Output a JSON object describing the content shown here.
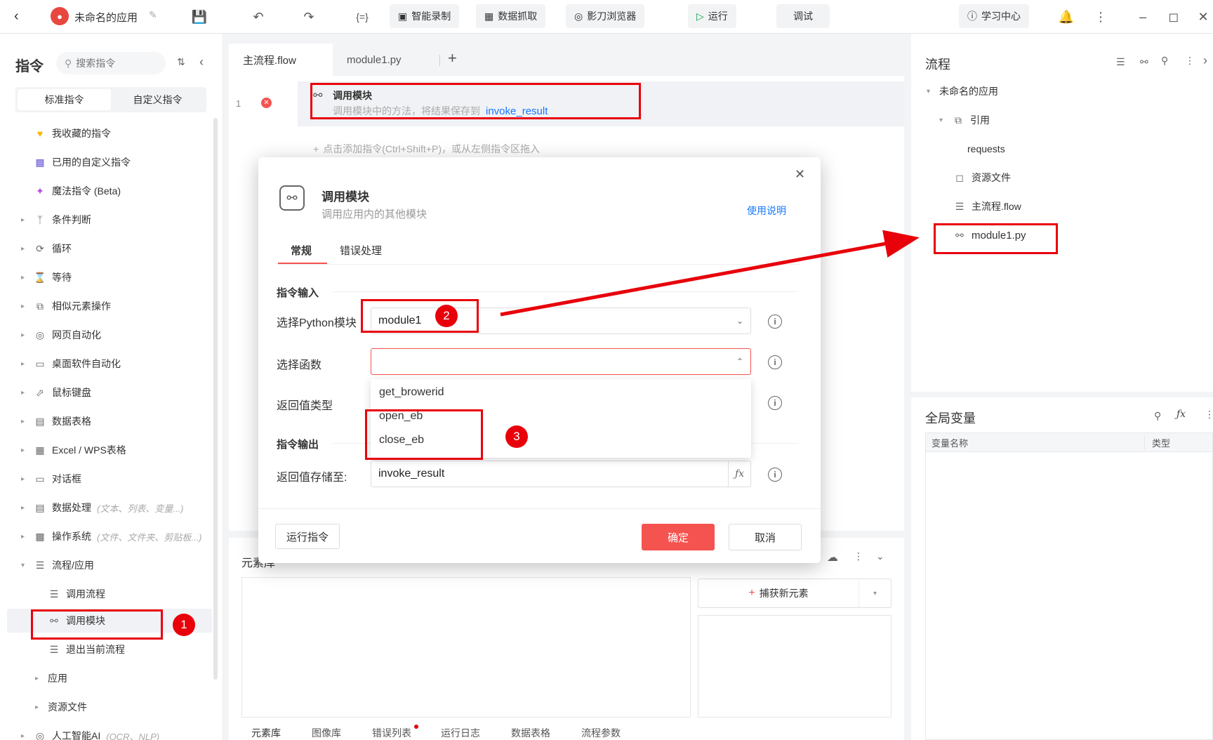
{
  "topbar": {
    "app_name": "未命名的应用",
    "buttons": {
      "smart_record": "智能录制",
      "data_capture": "数据抓取",
      "browser": "影刀浏览器",
      "run": "运行",
      "debug": "调试",
      "learning": "学习中心"
    }
  },
  "left": {
    "title": "指令",
    "search_placeholder": "搜索指令",
    "tabs": [
      "标准指令",
      "自定义指令"
    ],
    "items": {
      "fav": "我收藏的指令",
      "used_custom": "已用的自定义指令",
      "magic": "魔法指令 (Beta)",
      "cond": "条件判断",
      "loop": "循环",
      "wait": "等待",
      "similar": "相似元素操作",
      "web": "网页自动化",
      "desktop": "桌面软件自动化",
      "mouse": "鼠标键盘",
      "table": "数据表格",
      "excel": "Excel / WPS表格",
      "dialog": "对话框",
      "dataproc": "数据处理",
      "dataproc_hint": "(文本、列表、变量...)",
      "os": "操作系统",
      "os_hint": "(文件、文件夹、剪贴板...)",
      "flowapp": "流程/应用",
      "call_flow": "调用流程",
      "call_module": "调用模块",
      "exit_flow": "退出当前流程",
      "app": "应用",
      "resource": "资源文件",
      "ai": "人工智能AI",
      "ai_hint": "(OCR、NLP)"
    }
  },
  "editor": {
    "tabs": [
      "主流程.flow",
      "module1.py"
    ],
    "line_number": "1",
    "step_title": "调用模块",
    "step_desc": "调用模块中的方法，将结果保存到",
    "step_var": "invoke_result",
    "add_hint": "点击添加指令(Ctrl+Shift+P)，或从左侧指令区拖入"
  },
  "bottom": {
    "title": "元素库",
    "capture_button": "捕获新元素",
    "tabs": [
      "元素库",
      "图像库",
      "错误列表",
      "运行日志",
      "数据表格",
      "流程参数"
    ]
  },
  "right": {
    "title": "流程",
    "tree": {
      "root": "未命名的应用",
      "ref": "引用",
      "requests": "requests",
      "resource": "资源文件",
      "mainflow": "主流程.flow",
      "module": "module1.py"
    },
    "globals_title": "全局变量",
    "columns": [
      "变量名称",
      "类型"
    ]
  },
  "dialog": {
    "title": "调用模块",
    "subtitle": "调用应用内的其他模块",
    "help_link": "使用说明",
    "tabs": [
      "常规",
      "错误处理"
    ],
    "section_input": "指令输入",
    "label_module": "选择Python模块",
    "module_value": "module1",
    "label_function": "选择函数",
    "label_return_type": "返回值类型",
    "options": [
      "get_browerid",
      "open_eb",
      "close_eb"
    ],
    "section_output": "指令输出",
    "label_store": "返回值存储至:",
    "store_value": "invoke_result",
    "run_button": "运行指令",
    "ok_button": "确定",
    "cancel_button": "取消"
  },
  "annotations": [
    "1",
    "2",
    "3"
  ],
  "colors": {
    "accent": "#1677ff",
    "danger": "#f5534f",
    "annotation": "#e8000b"
  }
}
